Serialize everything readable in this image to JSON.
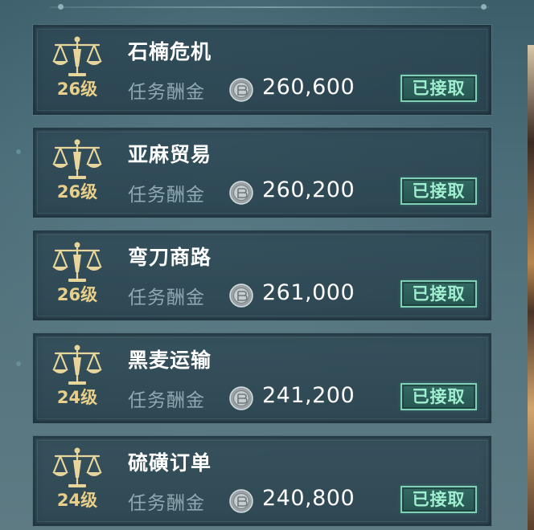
{
  "tasks": [
    {
      "level": "26级",
      "title": "石楠危机",
      "reward_label": "任务酬金",
      "reward": "260,600",
      "status": "已接取"
    },
    {
      "level": "26级",
      "title": "亚麻贸易",
      "reward_label": "任务酬金",
      "reward": "260,200",
      "status": "已接取"
    },
    {
      "level": "26级",
      "title": "弯刀商路",
      "reward_label": "任务酬金",
      "reward": "261,000",
      "status": "已接取"
    },
    {
      "level": "24级",
      "title": "黑麦运输",
      "reward_label": "任务酬金",
      "reward": "241,200",
      "status": "已接取"
    },
    {
      "level": "24级",
      "title": "硫磺订单",
      "reward_label": "任务酬金",
      "reward": "240,800",
      "status": "已接取"
    }
  ],
  "icons": {
    "task": "scales-icon",
    "currency": "silver-coin-icon"
  },
  "colors": {
    "level_text": "#e8cf8a",
    "accepted_accent": "#7fd1b5",
    "reward_label": "#8fa9b2"
  }
}
